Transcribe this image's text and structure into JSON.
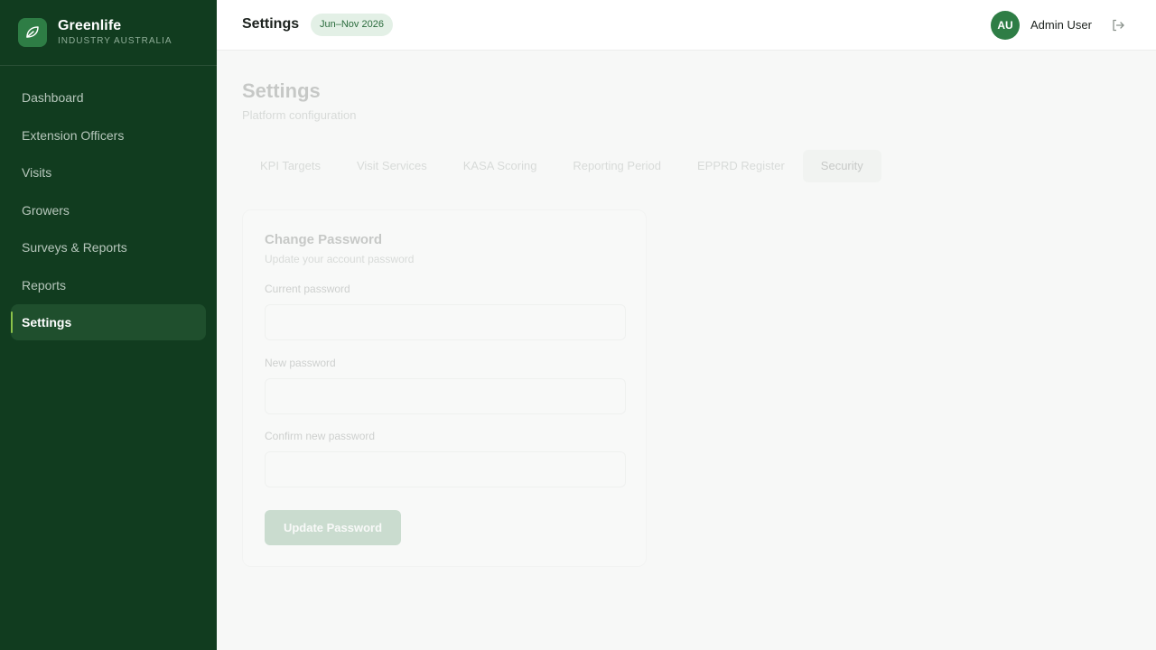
{
  "brand": {
    "name": "Greenlife",
    "subtitle": "INDUSTRY AUSTRALIA",
    "icon": "leaf-icon",
    "accent": "#2e7d45"
  },
  "sidebar": {
    "items": [
      {
        "label": "Dashboard",
        "active": false
      },
      {
        "label": "Extension Officers",
        "active": false
      },
      {
        "label": "Visits",
        "active": false
      },
      {
        "label": "Growers",
        "active": false
      },
      {
        "label": "Surveys & Reports",
        "active": false
      },
      {
        "label": "Reports",
        "active": false
      },
      {
        "label": "Settings",
        "active": true
      }
    ]
  },
  "header": {
    "title": "Settings",
    "period_badge": "Jun–Nov 2026",
    "user": {
      "initials": "AU",
      "name": "Admin User"
    },
    "logout_icon": "logout-icon"
  },
  "page": {
    "title": "Settings",
    "subtitle": "Platform configuration",
    "tabs": [
      {
        "label": "KPI Targets",
        "active": false
      },
      {
        "label": "Visit Services",
        "active": false
      },
      {
        "label": "KASA Scoring",
        "active": false
      },
      {
        "label": "Reporting Period",
        "active": false
      },
      {
        "label": "EPPRD Register",
        "active": false
      },
      {
        "label": "Security",
        "active": true
      }
    ]
  },
  "password_card": {
    "title": "Change Password",
    "subtitle": "Update your account password",
    "fields": [
      {
        "label": "Current password",
        "value": "",
        "placeholder": ""
      },
      {
        "label": "New password",
        "value": "",
        "placeholder": ""
      },
      {
        "label": "Confirm new password",
        "value": "",
        "placeholder": ""
      }
    ],
    "submit_label": "Update Password"
  },
  "colors": {
    "sidebar_bg": "#113c1f",
    "active_indicator": "#8bc34a",
    "badge_bg": "#e3f0e6"
  }
}
